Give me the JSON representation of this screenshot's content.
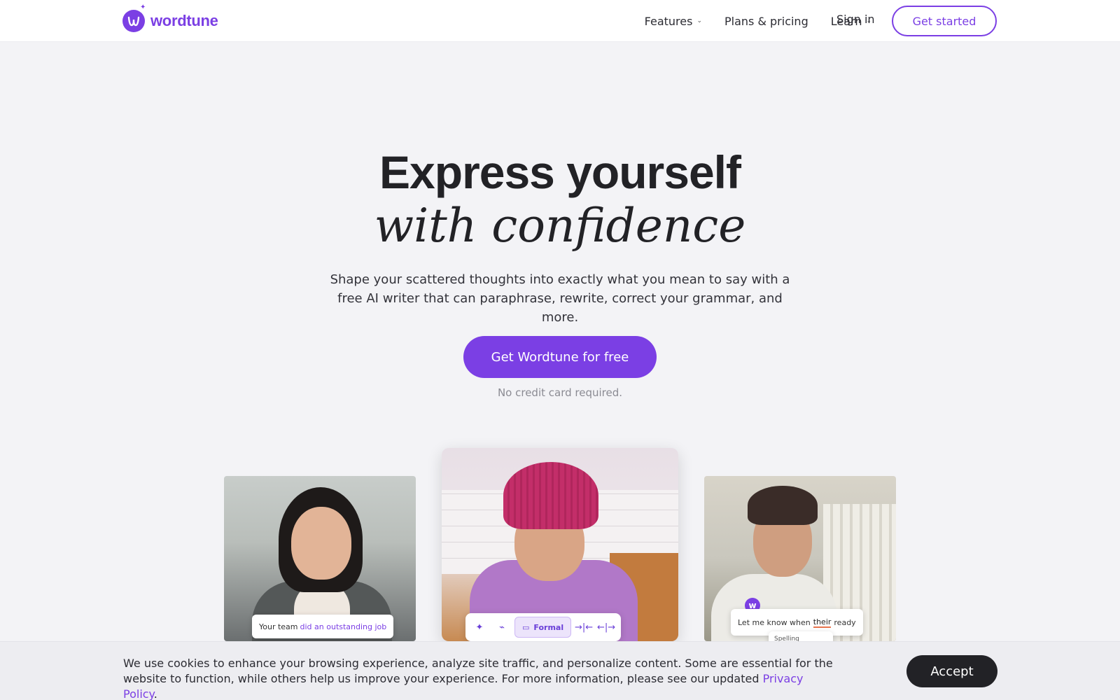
{
  "brand": {
    "name": "wordtune",
    "color": "#7b3fe4"
  },
  "nav": {
    "links": [
      {
        "label": "Features",
        "has_dropdown": true
      },
      {
        "label": "Plans & pricing",
        "has_dropdown": false
      },
      {
        "label": "Learn",
        "has_dropdown": true
      }
    ],
    "signin_label": "Sign in",
    "get_started_label": "Get started"
  },
  "hero": {
    "title_line1": "Express yourself",
    "title_line2": "with confidence",
    "subtitle": "Shape your scattered thoughts into exactly what you mean to say with a free AI writer that can paraphrase, rewrite, correct your grammar, and more.",
    "cta_label": "Get Wordtune for free",
    "cta_note": "No credit card required."
  },
  "cards": {
    "left": {
      "chip_prefix": "Your team",
      "chip_highlight": "did an outstanding job"
    },
    "middle": {
      "toolbar_active": "Formal",
      "toolbar_icons": [
        "sparkle-icon",
        "shoe-icon",
        "briefcase-icon",
        "shorten-icon",
        "expand-icon"
      ]
    },
    "right": {
      "chip_prefix": "Let me know when",
      "chip_error": "their",
      "chip_suffix": "ready",
      "suggestion_label": "Spelling",
      "badge_letter": "w"
    }
  },
  "cookie": {
    "text": "We use cookies to enhance your browsing experience, analyze site traffic, and personalize content. Some are essential for the website to function, while others help us improve your experience. For more information, please see our updated",
    "link_label": "Privacy Policy",
    "trailing": ".",
    "accept_label": "Accept"
  }
}
